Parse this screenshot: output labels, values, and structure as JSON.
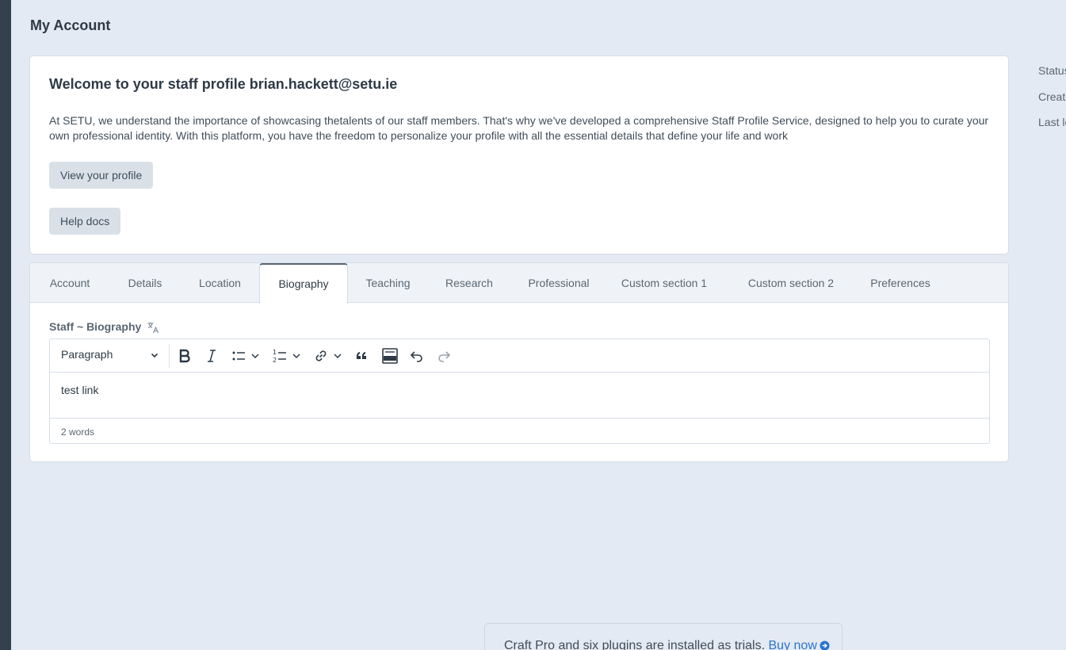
{
  "page": {
    "title": "My Account"
  },
  "welcome": {
    "heading": "Welcome to your staff profile brian.hackett@setu.ie",
    "body": "At SETU, we understand the importance of showcasing thetalents of our staff members. That's why we've developed a comprehensive Staff Profile Service, designed to help you to curate your own professional identity. With this platform, you have the freedom to personalize your profile with all the essential details that define your life and work",
    "view_profile_label": "View your profile",
    "help_docs_label": "Help docs"
  },
  "tabs": [
    {
      "label": "Account"
    },
    {
      "label": "Details"
    },
    {
      "label": "Location"
    },
    {
      "label": "Biography",
      "active": true
    },
    {
      "label": "Teaching"
    },
    {
      "label": "Research"
    },
    {
      "label": "Professional"
    },
    {
      "label": "Custom section 1"
    },
    {
      "label": "Custom section 2"
    },
    {
      "label": "Preferences"
    }
  ],
  "biography": {
    "field_label": "Staff ~ Biography",
    "format_select": "Paragraph",
    "content": "test link",
    "word_count": "2 words"
  },
  "toolbar_icons": [
    "bold-icon",
    "italic-icon",
    "bulleted-list-icon",
    "numbered-list-icon",
    "link-icon",
    "blockquote-icon",
    "html-embed-icon",
    "undo-icon",
    "redo-icon"
  ],
  "meta": {
    "status_label": "Status",
    "created_label": "Create",
    "last_login_label": "Last lo"
  },
  "trial_banner": {
    "text": "Craft Pro and six plugins are installed as trials.",
    "link": "Buy now"
  },
  "colors": {
    "background": "#e4eaf3",
    "sidebar": "#33404d",
    "link": "#2a74d0"
  }
}
